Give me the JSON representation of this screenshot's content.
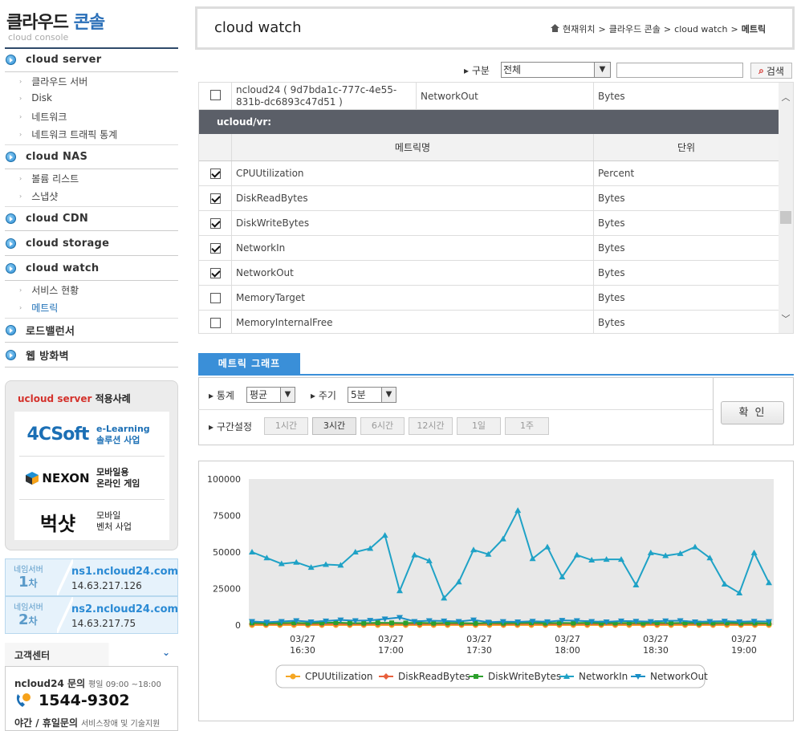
{
  "sidebar": {
    "logo_main": "클라우드",
    "logo_accent": "콘솔",
    "logo_sub": "cloud console",
    "menu": [
      {
        "label": "cloud server",
        "subs": [
          "클라우드 서버",
          "Disk",
          "네트워크",
          "네트워크 트래픽 통계"
        ]
      },
      {
        "label": "cloud NAS",
        "subs": [
          "볼륨 리스트",
          "스냅샷"
        ]
      },
      {
        "label": "cloud CDN",
        "subs": []
      },
      {
        "label": "cloud storage",
        "subs": []
      },
      {
        "label": "cloud watch",
        "subs": [
          "서비스 현황",
          "메트릭"
        ]
      },
      {
        "label": "로드밸런서",
        "subs": []
      },
      {
        "label": "웹 방화벽",
        "subs": []
      }
    ],
    "active_sub": "메트릭",
    "case_title_red": "ucloud server",
    "case_title_rest": "적용사례",
    "cases": [
      {
        "logo": "4CSoft",
        "desc1": "e-Learning",
        "desc2": "솔루션 사업"
      },
      {
        "logo": "NEXON",
        "desc1": "모바일용",
        "desc2": "온라인 게임"
      },
      {
        "logo": "벅샷",
        "desc1": "모바일",
        "desc2": "벤처 사업"
      }
    ],
    "dns": [
      {
        "tag": "네임서버",
        "num": "1",
        "suffix": "차",
        "host": "ns1.ncloud24.com",
        "ip": "14.63.217.126"
      },
      {
        "tag": "네임서버",
        "num": "2",
        "suffix": "차",
        "host": "ns2.ncloud24.com",
        "ip": "14.63.217.75"
      }
    ],
    "cs_title": "고객센터",
    "cs_question": "ncloud24 문의",
    "cs_hours": "평일 09:00 ~18:00",
    "cs_phone": "1544-9302",
    "cs_night": "야간 / 휴일문의",
    "cs_night_note": "서비스장애 및 기술지원"
  },
  "header": {
    "title": "cloud watch",
    "breadcrumb": [
      "현재위치",
      "클라우드 콘솔",
      "cloud watch",
      "메트릭"
    ]
  },
  "filter": {
    "label": "구분",
    "selected": "전체",
    "input_value": "",
    "search_label": "검색"
  },
  "table": {
    "top_row": {
      "name": "ncloud24 ( 9d7bda1c-777c-4e55-831b-dc6893c47d51 )",
      "metric": "NetworkOut",
      "unit": "Bytes",
      "checked": false
    },
    "group_title": "ucloud/vr:",
    "headers": [
      "메트릭명",
      "단위"
    ],
    "rows": [
      {
        "name": "CPUUtilization",
        "unit": "Percent",
        "checked": true
      },
      {
        "name": "DiskReadBytes",
        "unit": "Bytes",
        "checked": true
      },
      {
        "name": "DiskWriteBytes",
        "unit": "Bytes",
        "checked": true
      },
      {
        "name": "NetworkIn",
        "unit": "Bytes",
        "checked": true
      },
      {
        "name": "NetworkOut",
        "unit": "Bytes",
        "checked": true
      },
      {
        "name": "MemoryTarget",
        "unit": "Bytes",
        "checked": false
      },
      {
        "name": "MemoryInternalFree",
        "unit": "Bytes",
        "checked": false
      }
    ]
  },
  "graph": {
    "tab_label": "메트릭 그래프",
    "stat_label": "통계",
    "stat_value": "평균",
    "period_label": "주기",
    "period_value": "5분",
    "range_label": "구간설정",
    "ranges": [
      "1시간",
      "3시간",
      "6시간",
      "12시간",
      "1일",
      "1주"
    ],
    "selected_range": "3시간",
    "ok_label": "확 인"
  },
  "chart_data": {
    "type": "line",
    "y_ticks": [
      "100000",
      "75000",
      "50000",
      "25000",
      "0"
    ],
    "ylim": [
      0,
      100000
    ],
    "x_tick_labels": [
      [
        "03/27",
        "16:30"
      ],
      [
        "03/27",
        "17:00"
      ],
      [
        "03/27",
        "17:30"
      ],
      [
        "03/27",
        "18:00"
      ],
      [
        "03/27",
        "18:30"
      ],
      [
        "03/27",
        "19:00"
      ]
    ],
    "grid": false,
    "legend_position": "bottom",
    "series": [
      {
        "name": "CPUUtilization",
        "color": "#f5a623",
        "marker": "circle",
        "values": [
          0,
          0,
          0,
          0,
          0,
          0,
          0,
          0,
          0,
          0,
          0,
          0,
          0,
          0,
          0,
          0,
          0,
          0,
          0,
          0,
          0,
          0,
          0,
          0,
          0,
          0,
          0,
          0,
          0,
          0,
          0,
          0,
          0,
          0,
          0,
          0,
          0,
          0
        ]
      },
      {
        "name": "DiskReadBytes",
        "color": "#e8603c",
        "marker": "diamond",
        "values": [
          800,
          600,
          700,
          900,
          600,
          700,
          800,
          600,
          700,
          800,
          900,
          700,
          600,
          800,
          700,
          600,
          700,
          800,
          600,
          700,
          800,
          700,
          600,
          800,
          700,
          600,
          700,
          800,
          700,
          600,
          800,
          700,
          600,
          700,
          800,
          600,
          700,
          800
        ]
      },
      {
        "name": "DiskWriteBytes",
        "color": "#2ca02c",
        "marker": "square",
        "values": [
          1500,
          1200,
          1400,
          1600,
          1300,
          1500,
          1700,
          1400,
          1300,
          1600,
          1500,
          1400,
          1600,
          1300,
          1500,
          1400,
          1200,
          1500,
          1300,
          1400,
          1600,
          1300,
          1500,
          1400,
          1600,
          1300,
          1400,
          1500,
          1300,
          1600,
          1400,
          1500,
          1300,
          1400,
          1500,
          1300,
          1400,
          1200
        ]
      },
      {
        "name": "NetworkIn",
        "color": "#1fa2c6",
        "marker": "triangle-up",
        "values": [
          50000,
          46000,
          42000,
          43000,
          39500,
          41500,
          41000,
          50000,
          52500,
          61500,
          23500,
          48000,
          44000,
          18500,
          29500,
          51500,
          48500,
          59000,
          78500,
          45500,
          53500,
          33000,
          48000,
          44500,
          45000,
          45000,
          27500,
          49500,
          47500,
          49000,
          53500,
          46000,
          28000,
          22000,
          49500,
          29000
        ]
      },
      {
        "name": "NetworkOut",
        "color": "#1a8fc6",
        "marker": "triangle-down",
        "values": [
          2500,
          2000,
          2500,
          3000,
          2200,
          2800,
          3500,
          3000,
          3200,
          4200,
          5200,
          2500,
          3000,
          2800,
          2500,
          3500,
          2000,
          2400,
          2200,
          2600,
          2300,
          3200,
          3000,
          2500,
          2200,
          2800,
          2600,
          2400,
          2900,
          3000,
          2200,
          2500,
          2700,
          2300,
          2600,
          2400
        ]
      }
    ]
  }
}
